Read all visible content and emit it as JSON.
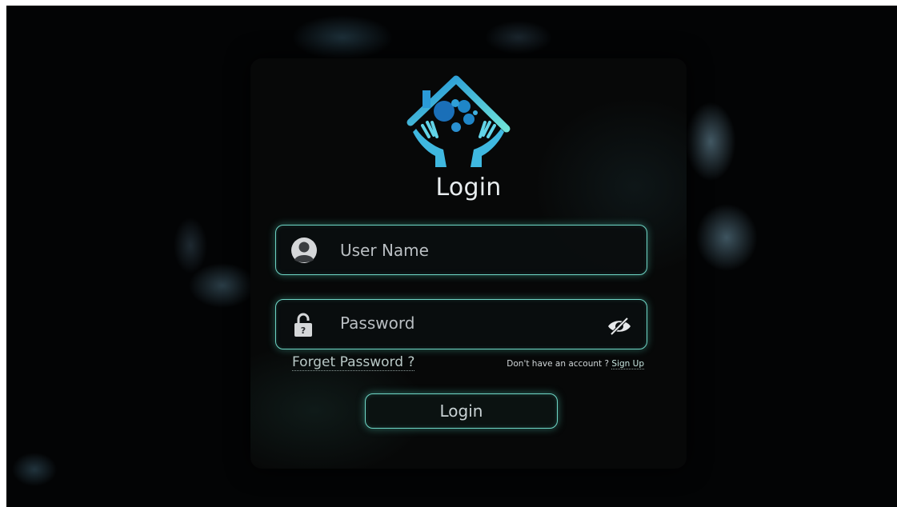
{
  "card": {
    "title": "Login"
  },
  "username": {
    "placeholder": "User Name"
  },
  "password": {
    "placeholder": "Password"
  },
  "links": {
    "forgot": "Forget Password ?",
    "no_account": "Don't have an account ?",
    "signup": "Sign Up"
  },
  "login_button": {
    "label": "Login"
  },
  "icons": {
    "logo": "house-hands-logo",
    "user": "user-avatar-icon",
    "lock": "lock-icon",
    "toggle": "eye-slash-icon"
  },
  "colors": {
    "accent": "#6fd6c6",
    "logo_blue": "#3fb8e0",
    "background": "#030405"
  }
}
